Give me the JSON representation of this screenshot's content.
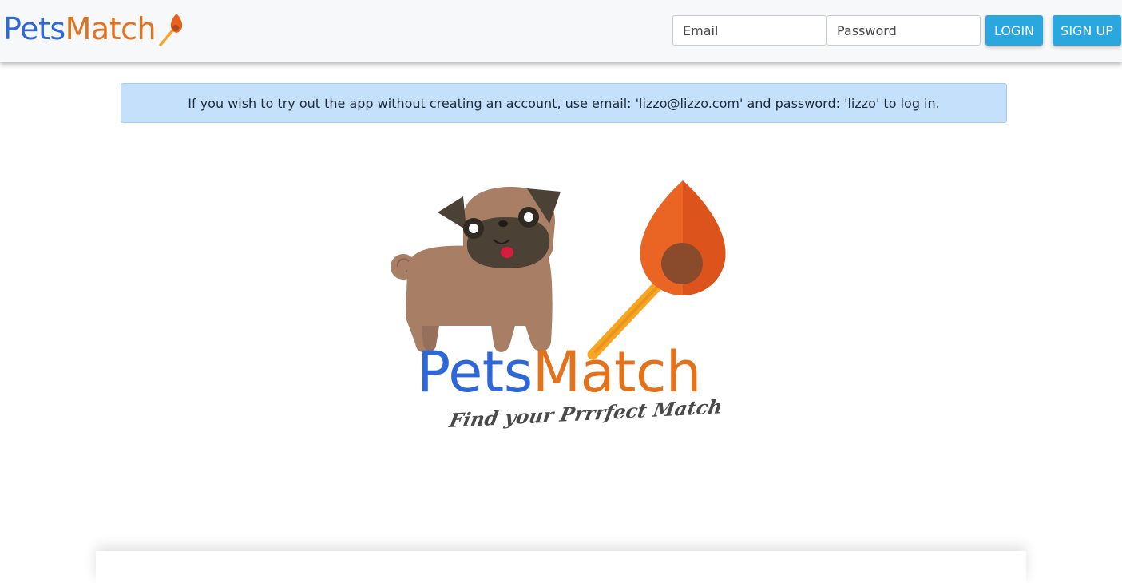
{
  "navbar": {
    "brand": {
      "part1": "Pets",
      "part2": "Match"
    },
    "email_placeholder": "Email",
    "password_placeholder": "Password",
    "login_label": "LOGIN",
    "signup_label": "SIGN UP"
  },
  "notice": {
    "text": "If you wish to try out the app without creating an account, use email: 'lizzo@lizzo.com' and password: 'lizzo' to log in."
  },
  "hero": {
    "title_part1": "Pets",
    "title_part2": "Match",
    "tagline": "Find your Prrrfect Match",
    "illustration": "pug-and-match-icon"
  },
  "colors": {
    "brand_blue": "#2e68d8",
    "brand_orange": "#e2731c",
    "button": "#2aa7df",
    "notice_bg": "#c5e0fa"
  }
}
